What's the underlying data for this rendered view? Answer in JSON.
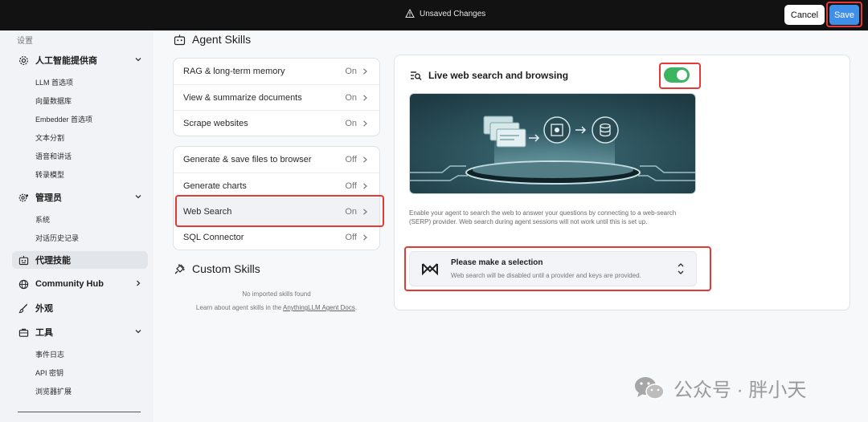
{
  "topbar": {
    "unsaved_label": "Unsaved Changes",
    "cancel_label": "Cancel",
    "save_label": "Save"
  },
  "sidebar": {
    "caption": "设置",
    "groups": [
      {
        "label": "人工智能提供商",
        "icon": "gear-icon",
        "items": [
          "LLM 首选项",
          "向量数据库",
          "Embedder 首选项",
          "文本分割",
          "语音和讲话",
          "转录模型"
        ]
      },
      {
        "label": "管理员",
        "icon": "admin-gear-icon",
        "items": [
          "系统",
          "对话历史记录"
        ]
      },
      {
        "label": "代理技能",
        "icon": "robot-icon",
        "items": []
      },
      {
        "label": "Community Hub",
        "icon": "globe-icon",
        "items": []
      },
      {
        "label": "外观",
        "icon": "brush-icon",
        "items": []
      },
      {
        "label": "工具",
        "icon": "toolbox-icon",
        "items": [
          "事件日志",
          "API 密钥",
          "浏览器扩展"
        ]
      }
    ]
  },
  "agent_skills": {
    "title": "Agent Skills",
    "default_skills": [
      {
        "label": "RAG & long-term memory",
        "state": "On"
      },
      {
        "label": "View & summarize documents",
        "state": "On"
      },
      {
        "label": "Scrape websites",
        "state": "On"
      }
    ],
    "configurable_skills": [
      {
        "label": "Generate & save files to browser",
        "state": "Off"
      },
      {
        "label": "Generate charts",
        "state": "Off"
      },
      {
        "label": "Web Search",
        "state": "On"
      },
      {
        "label": "SQL Connector",
        "state": "Off"
      }
    ]
  },
  "custom_skills": {
    "title": "Custom Skills",
    "empty_text": "No imported skills found",
    "learn_prefix": "Learn about agent skills in the ",
    "learn_link": "AnythingLLM Agent Docs",
    "learn_suffix": "."
  },
  "web_search_panel": {
    "title": "Live web search and browsing",
    "enabled": true,
    "toggle_color": "#3db462",
    "description": "Enable your agent to search the web to answer your questions by connecting to a web-search (SERP) provider. Web search during agent sessions will not work until this is set up.",
    "provider_title": "Please make a selection",
    "provider_subtitle": "Web search will be disabled until a provider and keys are provided."
  },
  "watermark": {
    "text": "公众号 · 胖小天",
    "icon": "wechat-icon"
  },
  "colors": {
    "topbar": "#121212",
    "save_button": "#3f8ee8",
    "highlight_frame": "#e53935",
    "sidebar_bg": "#f1f3f6"
  }
}
